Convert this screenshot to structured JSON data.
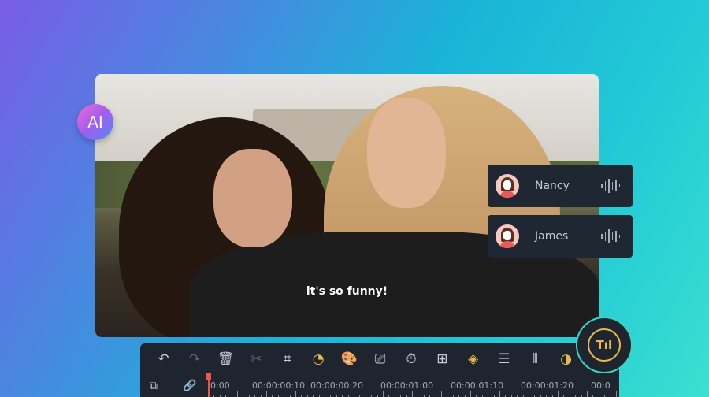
{
  "ai_badge": "AI",
  "video": {
    "caption": "it's so funny!"
  },
  "speakers": [
    {
      "name": "Nancy"
    },
    {
      "name": "James"
    }
  ],
  "toolbar": {
    "tools": [
      {
        "name": "undo",
        "glyph": "↶",
        "state": "normal"
      },
      {
        "name": "redo",
        "glyph": "↷",
        "state": "disabled"
      },
      {
        "name": "delete",
        "glyph": "🗑",
        "state": "normal"
      },
      {
        "name": "cut",
        "glyph": "✂",
        "state": "disabled"
      },
      {
        "name": "crop",
        "glyph": "⌗",
        "state": "normal"
      },
      {
        "name": "speed",
        "glyph": "◔",
        "state": "active"
      },
      {
        "name": "color",
        "glyph": "🎨",
        "state": "normal"
      },
      {
        "name": "presentation",
        "glyph": "⎚",
        "state": "normal"
      },
      {
        "name": "timer",
        "glyph": "⏱",
        "state": "normal"
      },
      {
        "name": "focus",
        "glyph": "⊞",
        "state": "normal"
      },
      {
        "name": "keyframe",
        "glyph": "◈",
        "state": "active"
      },
      {
        "name": "adjust",
        "glyph": "☰",
        "state": "normal"
      },
      {
        "name": "audio-split",
        "glyph": "⦀",
        "state": "normal"
      },
      {
        "name": "audio-sync",
        "glyph": "◑",
        "state": "active"
      }
    ]
  },
  "timeline": {
    "timecodes": [
      "00:00",
      "00:00:00:10",
      "00:00:00:20",
      "00:00:01:00",
      "00:00:01:10",
      "00:00:01:20",
      "00:0"
    ]
  },
  "feature_badge": "TıI",
  "colors": {
    "accent": "#e8b949",
    "playhead": "#f0544a",
    "panel": "#1e252f",
    "ring": "#3ad6c4"
  }
}
